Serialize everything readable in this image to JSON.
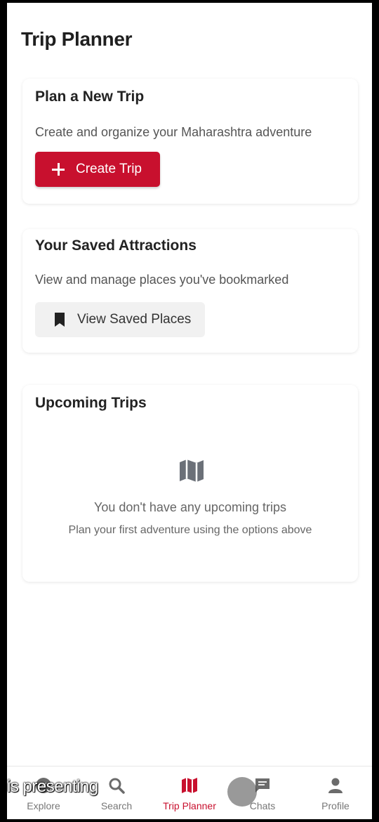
{
  "page": {
    "title": "Trip Planner"
  },
  "plan_card": {
    "title": "Plan a New Trip",
    "description": "Create and organize your Maharashtra adventure",
    "button_label": "Create Trip",
    "button_icon": "plus-icon",
    "accent": "#c8102e"
  },
  "saved_card": {
    "title": "Your Saved Attractions",
    "description": "View and manage places you've bookmarked",
    "button_label": "View Saved Places",
    "button_icon": "bookmark-icon"
  },
  "upcoming_card": {
    "title": "Upcoming Trips",
    "empty_icon": "map-icon",
    "empty_title": "You don't have any upcoming trips",
    "empty_subtitle": "Plan your first adventure using the options above"
  },
  "bottom_nav": {
    "items": [
      {
        "label": "Explore",
        "icon": "compass-icon",
        "active": false
      },
      {
        "label": "Search",
        "icon": "search-icon",
        "active": false
      },
      {
        "label": "Trip Planner",
        "icon": "map-icon",
        "active": true
      },
      {
        "label": "Chats",
        "icon": "chat-icon",
        "active": false
      },
      {
        "label": "Profile",
        "icon": "person-icon",
        "active": false
      }
    ],
    "active_color": "#c8102e"
  },
  "overlay": {
    "caption": "is presenting"
  }
}
